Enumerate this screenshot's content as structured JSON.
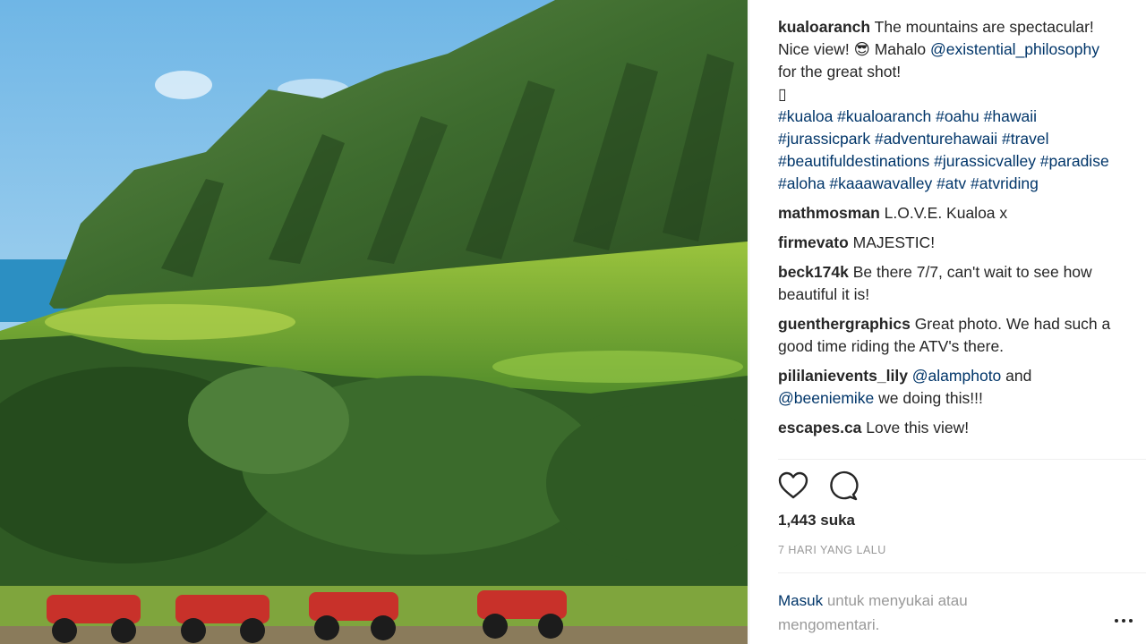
{
  "post": {
    "author": "kualoaranch",
    "caption": "The mountains are spectacular! Nice view! 😎 Mahalo",
    "caption_mention": "@existential_philosophy",
    "caption_tail": "for the great shot!",
    "caption_glyph": "▯",
    "hashtags": "#kualoa #kualoaranch #oahu #hawaii #jurassicpark #adventurehawaii #travel #beautifuldestinations #jurassicvalley #paradise #aloha #kaaawavalley #atv #atvriding"
  },
  "comments": [
    {
      "user": "mathmosman",
      "text": "L.O.V.E. Kualoa x"
    },
    {
      "user": "firmevato",
      "text": "MAJESTIC!"
    },
    {
      "user": "beck174k",
      "text": "Be there 7/7, can't wait to see how beautiful it is!"
    },
    {
      "user": "guenthergraphics",
      "text": "Great photo. We had such a good time riding the ATV's there."
    },
    {
      "user": "pililanievents_lily",
      "mention1": "@alamphoto",
      "mid": "and",
      "mention2": "@beeniemike",
      "text": "we doing this!!!"
    },
    {
      "user": "escapes.ca",
      "text": "Love this view!"
    }
  ],
  "actions": {
    "like_icon": "heart-icon",
    "comment_icon": "comment-bubble-icon"
  },
  "likes": "1,443 suka",
  "timestamp": "7 HARI YANG LALU",
  "login": {
    "link": "Masuk",
    "text": "untuk menyukai atau mengomentari."
  },
  "colors": {
    "link": "#003569",
    "muted": "#999999",
    "text": "#262626"
  }
}
